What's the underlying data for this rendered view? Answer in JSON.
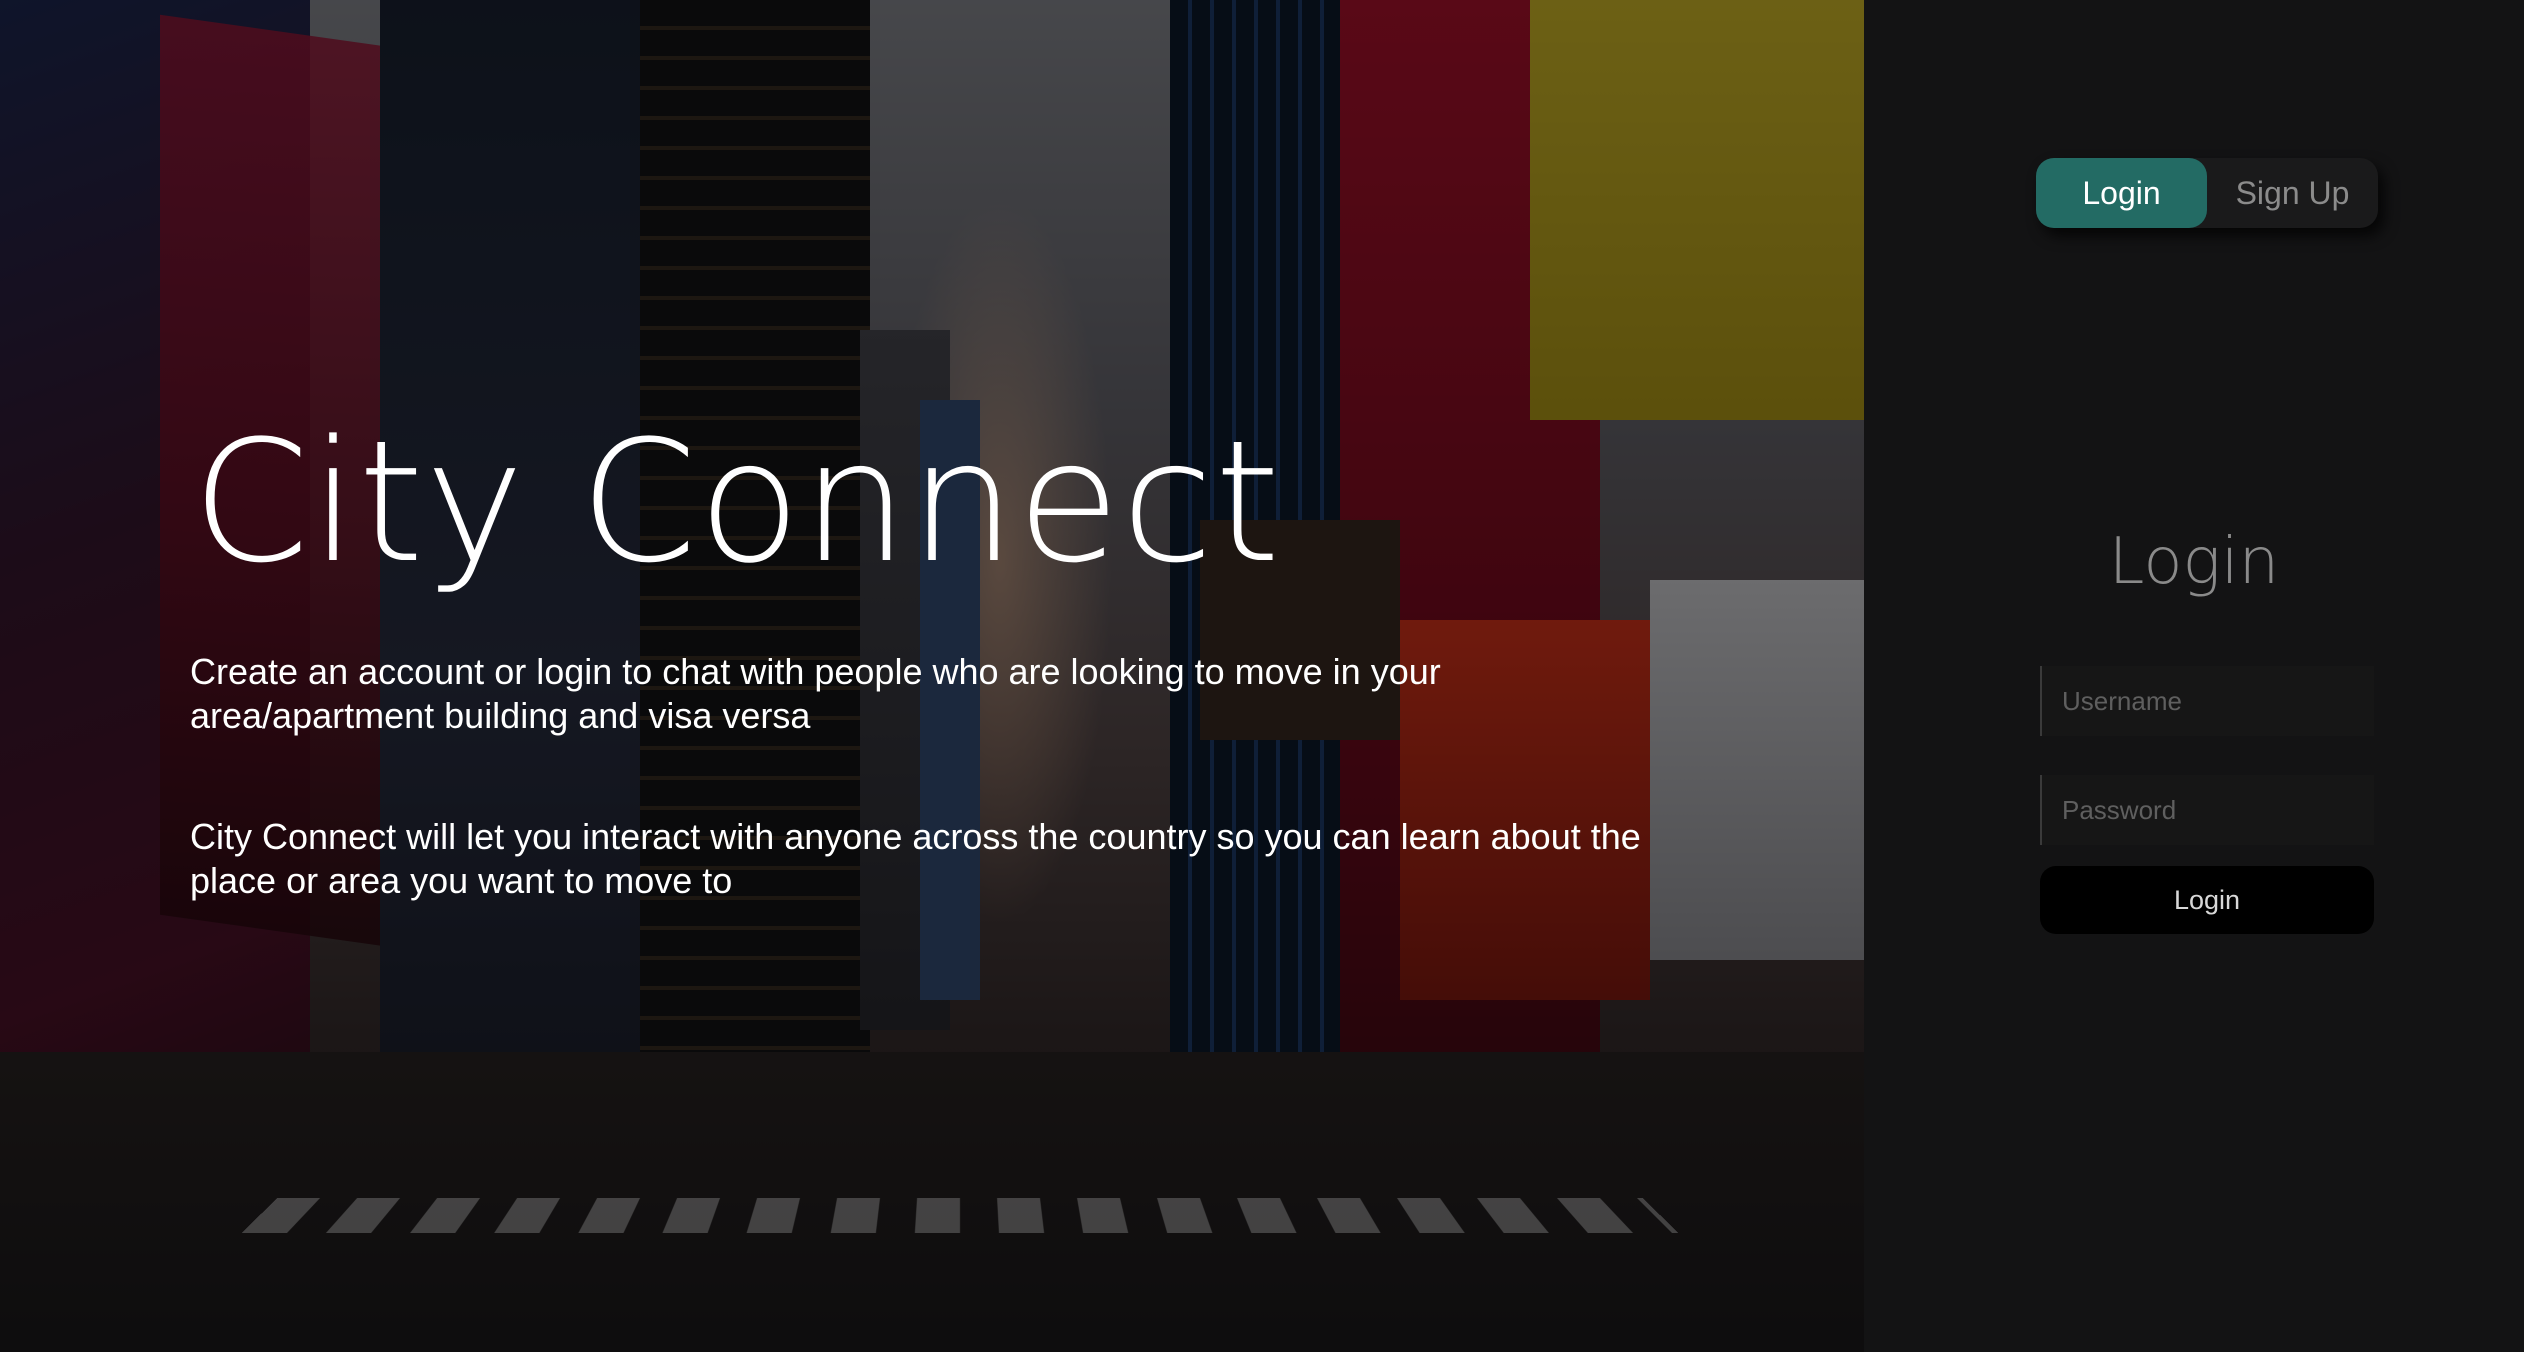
{
  "hero": {
    "title": "City Connect",
    "paragraph_1": "Create an account or login to chat with people who are looking to move in your area/apartment building and visa versa",
    "paragraph_2": "City Connect will let you interact with anyone across the country so you can learn about the place or area you want to move to"
  },
  "auth_toggle": {
    "login_label": "Login",
    "signup_label": "Sign Up",
    "active": "login"
  },
  "login_form": {
    "title": "Login",
    "username_placeholder": "Username",
    "password_placeholder": "Password",
    "submit_label": "Login"
  },
  "colors": {
    "accent": "#236b64",
    "panel_background": "#131314",
    "submit_background": "#000000"
  }
}
